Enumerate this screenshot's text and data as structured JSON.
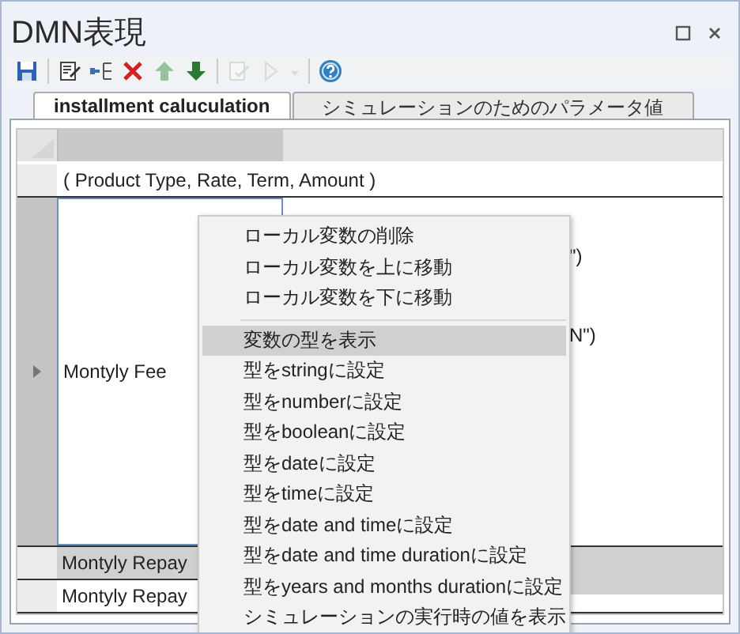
{
  "window": {
    "title": "DMN表現"
  },
  "toolbar": [
    {
      "kind": "save",
      "disabled": false
    },
    {
      "kind": "separator"
    },
    {
      "kind": "edit",
      "disabled": false
    },
    {
      "kind": "tree",
      "disabled": false
    },
    {
      "kind": "delete",
      "disabled": false
    },
    {
      "kind": "up",
      "disabled": true
    },
    {
      "kind": "down",
      "disabled": false
    },
    {
      "kind": "separator"
    },
    {
      "kind": "check",
      "disabled": true
    },
    {
      "kind": "run",
      "disabled": true
    },
    {
      "kind": "caret",
      "disabled": true
    },
    {
      "kind": "separator"
    },
    {
      "kind": "help",
      "disabled": false
    }
  ],
  "tabs": [
    {
      "label": "installment caluculation",
      "selected": true
    },
    {
      "label": "シミュレーションのためのパラメータ値",
      "selected": false
    }
  ],
  "grid": {
    "expression": "( Product Type, Rate, Term, Amount )",
    "rows": [
      {
        "label": "Montyly Fee",
        "current": true,
        "selected": false,
        "value_lines": [
          "\")",
          "N\")"
        ]
      },
      {
        "label": "Montyly Repay",
        "current": false,
        "selected": true,
        "value_lines": []
      },
      {
        "label": "Montyly Repay",
        "current": false,
        "selected": false,
        "value_lines": []
      }
    ]
  },
  "context_menu": [
    {
      "kind": "item",
      "label": "ローカル変数の削除",
      "selected": false
    },
    {
      "kind": "item",
      "label": "ローカル変数を上に移動",
      "selected": false
    },
    {
      "kind": "item",
      "label": "ローカル変数を下に移動",
      "selected": false
    },
    {
      "kind": "separator"
    },
    {
      "kind": "item",
      "label": "変数の型を表示",
      "selected": true
    },
    {
      "kind": "item",
      "label": "型をstringに設定",
      "selected": false
    },
    {
      "kind": "item",
      "label": "型をnumberに設定",
      "selected": false
    },
    {
      "kind": "item",
      "label": "型をbooleanに設定",
      "selected": false
    },
    {
      "kind": "item",
      "label": "型をdateに設定",
      "selected": false
    },
    {
      "kind": "item",
      "label": "型をtimeに設定",
      "selected": false
    },
    {
      "kind": "item",
      "label": "型をdate and timeに設定",
      "selected": false
    },
    {
      "kind": "item",
      "label": "型をdate and time durationに設定",
      "selected": false
    },
    {
      "kind": "item",
      "label": "型をyears and months durationに設定",
      "selected": false
    },
    {
      "kind": "item",
      "label": "シミュレーションの実行時の値を表示",
      "selected": false
    }
  ]
}
